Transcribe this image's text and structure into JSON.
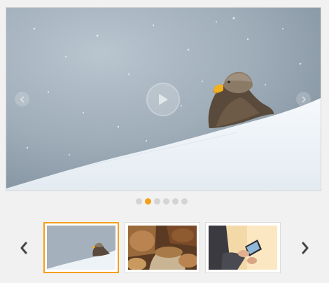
{
  "slider": {
    "slide_count": 6,
    "active_index": 1,
    "main_image": "eagle-in-snow",
    "play_icon": "play-icon",
    "prev_icon": "chevron-left-icon",
    "next_icon": "chevron-right-icon"
  },
  "thumbnails": [
    {
      "image": "eagle-in-snow",
      "active": true
    },
    {
      "image": "grain-sacks",
      "active": false
    },
    {
      "image": "person-using-tablet",
      "active": false
    }
  ],
  "thumb_nav": {
    "prev_icon": "arrow-left-icon",
    "next_icon": "arrow-right-icon"
  },
  "colors": {
    "accent": "#f4a01c",
    "dot_inactive": "#d4d4d4",
    "background": "#f1f1f1"
  }
}
